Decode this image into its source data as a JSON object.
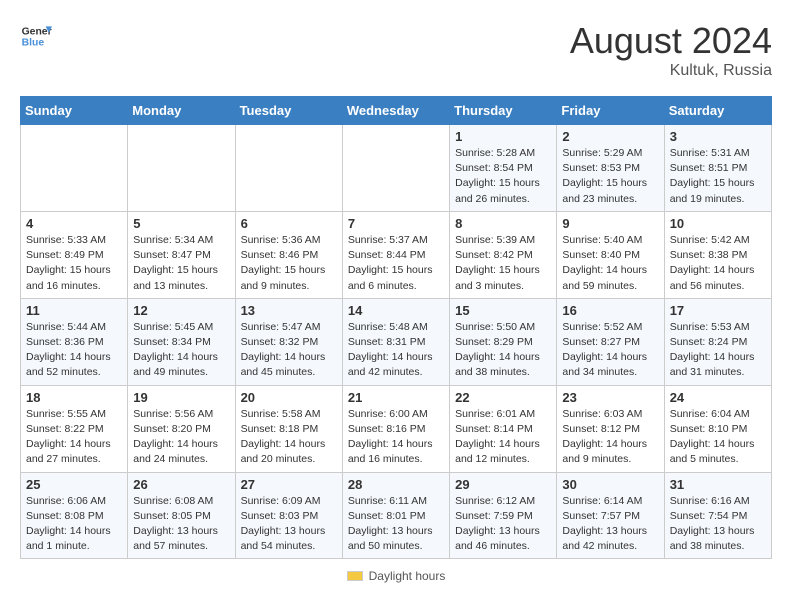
{
  "header": {
    "logo_line1": "General",
    "logo_line2": "Blue",
    "month": "August 2024",
    "location": "Kultuk, Russia"
  },
  "days_of_week": [
    "Sunday",
    "Monday",
    "Tuesday",
    "Wednesday",
    "Thursday",
    "Friday",
    "Saturday"
  ],
  "footer": {
    "daylight_label": "Daylight hours"
  },
  "weeks": [
    [
      {
        "day": "",
        "info": ""
      },
      {
        "day": "",
        "info": ""
      },
      {
        "day": "",
        "info": ""
      },
      {
        "day": "",
        "info": ""
      },
      {
        "day": "1",
        "info": "Sunrise: 5:28 AM\nSunset: 8:54 PM\nDaylight: 15 hours\nand 26 minutes."
      },
      {
        "day": "2",
        "info": "Sunrise: 5:29 AM\nSunset: 8:53 PM\nDaylight: 15 hours\nand 23 minutes."
      },
      {
        "day": "3",
        "info": "Sunrise: 5:31 AM\nSunset: 8:51 PM\nDaylight: 15 hours\nand 19 minutes."
      }
    ],
    [
      {
        "day": "4",
        "info": "Sunrise: 5:33 AM\nSunset: 8:49 PM\nDaylight: 15 hours\nand 16 minutes."
      },
      {
        "day": "5",
        "info": "Sunrise: 5:34 AM\nSunset: 8:47 PM\nDaylight: 15 hours\nand 13 minutes."
      },
      {
        "day": "6",
        "info": "Sunrise: 5:36 AM\nSunset: 8:46 PM\nDaylight: 15 hours\nand 9 minutes."
      },
      {
        "day": "7",
        "info": "Sunrise: 5:37 AM\nSunset: 8:44 PM\nDaylight: 15 hours\nand 6 minutes."
      },
      {
        "day": "8",
        "info": "Sunrise: 5:39 AM\nSunset: 8:42 PM\nDaylight: 15 hours\nand 3 minutes."
      },
      {
        "day": "9",
        "info": "Sunrise: 5:40 AM\nSunset: 8:40 PM\nDaylight: 14 hours\nand 59 minutes."
      },
      {
        "day": "10",
        "info": "Sunrise: 5:42 AM\nSunset: 8:38 PM\nDaylight: 14 hours\nand 56 minutes."
      }
    ],
    [
      {
        "day": "11",
        "info": "Sunrise: 5:44 AM\nSunset: 8:36 PM\nDaylight: 14 hours\nand 52 minutes."
      },
      {
        "day": "12",
        "info": "Sunrise: 5:45 AM\nSunset: 8:34 PM\nDaylight: 14 hours\nand 49 minutes."
      },
      {
        "day": "13",
        "info": "Sunrise: 5:47 AM\nSunset: 8:32 PM\nDaylight: 14 hours\nand 45 minutes."
      },
      {
        "day": "14",
        "info": "Sunrise: 5:48 AM\nSunset: 8:31 PM\nDaylight: 14 hours\nand 42 minutes."
      },
      {
        "day": "15",
        "info": "Sunrise: 5:50 AM\nSunset: 8:29 PM\nDaylight: 14 hours\nand 38 minutes."
      },
      {
        "day": "16",
        "info": "Sunrise: 5:52 AM\nSunset: 8:27 PM\nDaylight: 14 hours\nand 34 minutes."
      },
      {
        "day": "17",
        "info": "Sunrise: 5:53 AM\nSunset: 8:24 PM\nDaylight: 14 hours\nand 31 minutes."
      }
    ],
    [
      {
        "day": "18",
        "info": "Sunrise: 5:55 AM\nSunset: 8:22 PM\nDaylight: 14 hours\nand 27 minutes."
      },
      {
        "day": "19",
        "info": "Sunrise: 5:56 AM\nSunset: 8:20 PM\nDaylight: 14 hours\nand 24 minutes."
      },
      {
        "day": "20",
        "info": "Sunrise: 5:58 AM\nSunset: 8:18 PM\nDaylight: 14 hours\nand 20 minutes."
      },
      {
        "day": "21",
        "info": "Sunrise: 6:00 AM\nSunset: 8:16 PM\nDaylight: 14 hours\nand 16 minutes."
      },
      {
        "day": "22",
        "info": "Sunrise: 6:01 AM\nSunset: 8:14 PM\nDaylight: 14 hours\nand 12 minutes."
      },
      {
        "day": "23",
        "info": "Sunrise: 6:03 AM\nSunset: 8:12 PM\nDaylight: 14 hours\nand 9 minutes."
      },
      {
        "day": "24",
        "info": "Sunrise: 6:04 AM\nSunset: 8:10 PM\nDaylight: 14 hours\nand 5 minutes."
      }
    ],
    [
      {
        "day": "25",
        "info": "Sunrise: 6:06 AM\nSunset: 8:08 PM\nDaylight: 14 hours\nand 1 minute."
      },
      {
        "day": "26",
        "info": "Sunrise: 6:08 AM\nSunset: 8:05 PM\nDaylight: 13 hours\nand 57 minutes."
      },
      {
        "day": "27",
        "info": "Sunrise: 6:09 AM\nSunset: 8:03 PM\nDaylight: 13 hours\nand 54 minutes."
      },
      {
        "day": "28",
        "info": "Sunrise: 6:11 AM\nSunset: 8:01 PM\nDaylight: 13 hours\nand 50 minutes."
      },
      {
        "day": "29",
        "info": "Sunrise: 6:12 AM\nSunset: 7:59 PM\nDaylight: 13 hours\nand 46 minutes."
      },
      {
        "day": "30",
        "info": "Sunrise: 6:14 AM\nSunset: 7:57 PM\nDaylight: 13 hours\nand 42 minutes."
      },
      {
        "day": "31",
        "info": "Sunrise: 6:16 AM\nSunset: 7:54 PM\nDaylight: 13 hours\nand 38 minutes."
      }
    ]
  ]
}
